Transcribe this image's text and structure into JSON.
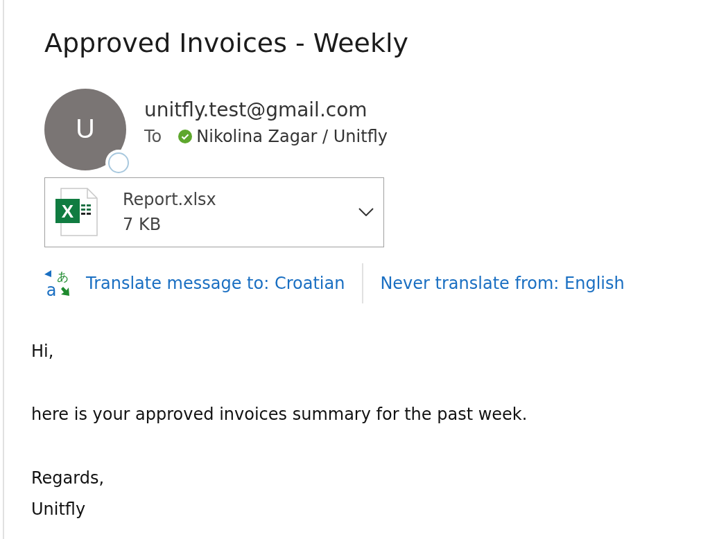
{
  "subject": "Approved Invoices - Weekly",
  "sender": {
    "avatar_letter": "U",
    "online": false,
    "address": "unitfly.test@gmail.com"
  },
  "recipients": {
    "label": "To",
    "items": [
      {
        "name": "Nikolina Zagar / Unitfly",
        "verified": true
      }
    ]
  },
  "attachments": [
    {
      "icon_letter": "X",
      "name": "Report.xlsx",
      "size": "7 KB"
    }
  ],
  "translate": {
    "icon_glyphs": [
      "a",
      "あ"
    ],
    "links": [
      "Translate message to: Croatian",
      "Never translate from: English"
    ]
  },
  "body": [
    "Hi,",
    "here is your approved invoices summary for the past week.",
    "Regards,\nUnitfly"
  ]
}
